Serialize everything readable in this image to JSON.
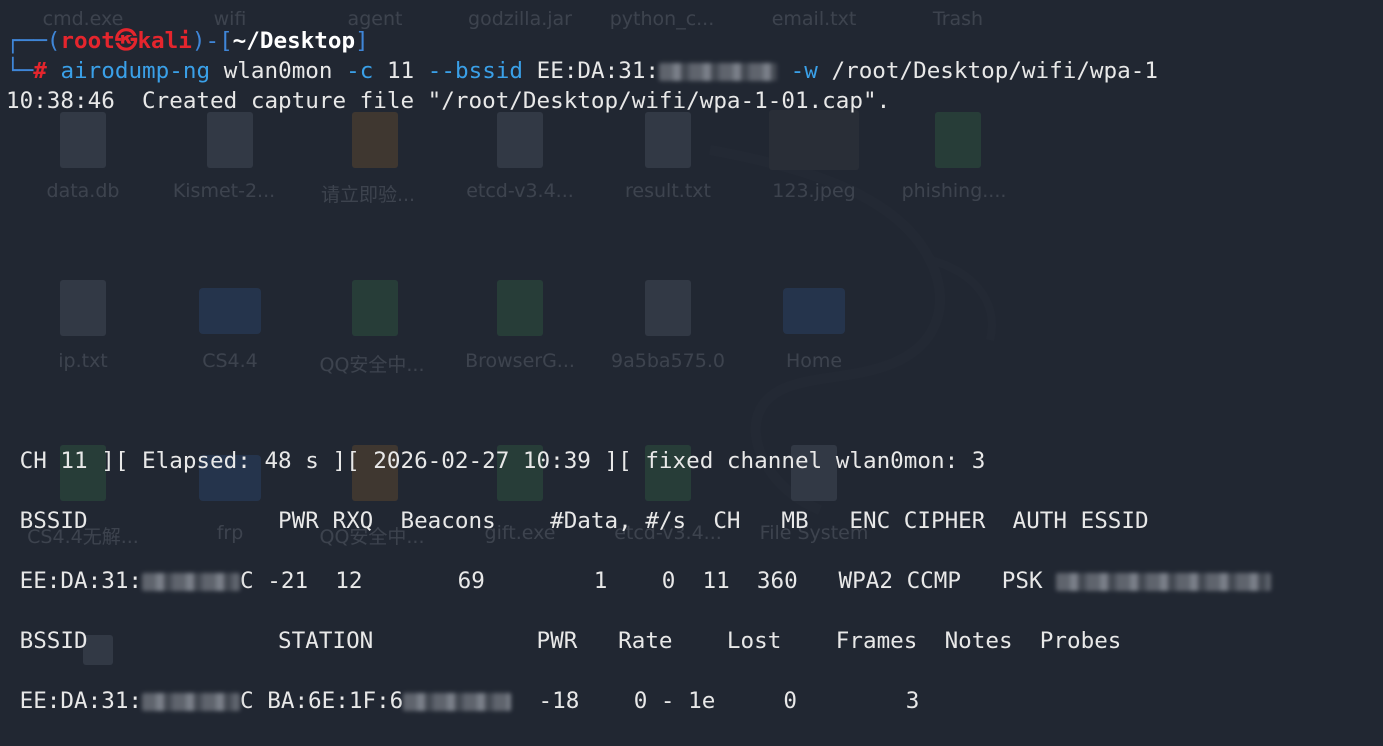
{
  "desktop": {
    "row1_labels": [
      "cmd.exe",
      "wifi",
      "agent",
      "godzilla.jar",
      "python_c...",
      "email.txt",
      "Trash"
    ],
    "row2_labels": [
      "data.db",
      "Kismet-2...",
      "请立即验...",
      "etcd-v3.4...",
      "result.txt",
      "123.jpeg",
      "phishing...."
    ],
    "row3_labels": [
      "ip.txt",
      "CS4.4",
      "QQ安全中...",
      "BrowserG...",
      "9a5ba575.0",
      "Home"
    ],
    "row4_labels": [
      "CS4.4无解...",
      "frp",
      "QQ安全中...",
      "gift.exe",
      "etcd-v3.4...",
      "File System"
    ]
  },
  "prompt": {
    "corner_top": "┌──(",
    "user": "root",
    "at": "㉿",
    "host": "kali",
    "mid": ")-[",
    "cwd": "~/Desktop",
    "end": "]",
    "corner_bottom": "└─",
    "hash": "#"
  },
  "command": {
    "program": "airodump-ng",
    "iface": "wlan0mon",
    "c_flag": "-c",
    "channel": "11",
    "bssid_flag": "--bssid",
    "bssid_partial": "EE:DA:31:",
    "w_flag": "-w",
    "output": "/root/Desktop/wifi/wpa-1"
  },
  "output_line": "10:38:46  Created capture file \"/root/Desktop/wifi/wpa-1-01.cap\".",
  "status_line": " CH 11 ][ Elapsed: 48 s ][ 2026-02-27 10:39 ][ fixed channel wlan0mon: 3",
  "ap_table": {
    "header": " BSSID              PWR RXQ  Beacons    #Data, #/s  CH   MB   ENC CIPHER  AUTH ESSID",
    "row_bssid": " EE:DA:31:",
    "row_bssid_tail": "C",
    "row_rest": " -21  12       69        1    0  11  360   WPA2 CCMP   PSK "
  },
  "station_table": {
    "header": " BSSID              STATION            PWR   Rate    Lost    Frames  Notes  Probes",
    "row_bssid": " EE:DA:31:",
    "row_bssid_tail": "C",
    "row_station": " BA:6E:1F:6",
    "row_rest": "  -18    0 - 1e     0        3"
  }
}
